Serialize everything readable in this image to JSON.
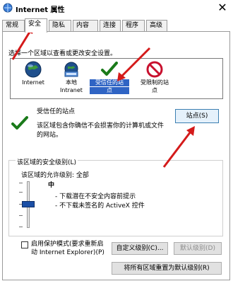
{
  "window": {
    "title": "Internet 属性",
    "close_glyph": "✕"
  },
  "tabs": [
    {
      "label": "常规"
    },
    {
      "label": "安全"
    },
    {
      "label": "隐私"
    },
    {
      "label": "内容"
    },
    {
      "label": "连接"
    },
    {
      "label": "程序"
    },
    {
      "label": "高级"
    }
  ],
  "security": {
    "prompt": "选择一个区域以查看或更改安全设置。",
    "zones": [
      {
        "label_line1": "Internet",
        "label_line2": "",
        "icon": "globe-icon"
      },
      {
        "label_line1": "本地",
        "label_line2": "Intranet",
        "icon": "local-intranet-icon"
      },
      {
        "label_line1": "受信任的站",
        "label_line2": "点",
        "icon": "checkmark-icon"
      },
      {
        "label_line1": "受限制的站",
        "label_line2": "点",
        "icon": "no-entry-icon"
      }
    ],
    "selected_zone": {
      "title": "受信任的站点",
      "description": "该区域包含你确信不会损害你的计算机或文件的网站。"
    },
    "sites_button": "站点(S)",
    "level_group": {
      "title": "该区域的安全级别(L)",
      "allowed_levels": "该区域的允许级别: 全部",
      "level": "中",
      "bullets": [
        "- 下载潜在不安全内容前提示",
        "- 不下载未签名的 ActiveX 控件"
      ],
      "protected_mode_label": "启用保护模式(要求重新启动 Internet Explorer)(P)",
      "protected_mode_checked": false,
      "custom_button": "自定义级别(C)...",
      "default_button": "默认级别(D)"
    },
    "reset_all_button": "将所有区域重置为默认级别(R)"
  },
  "colors": {
    "selection": "#2f64c4",
    "annotation_arrow": "#d41a1a",
    "slider_thumb": "#1b4fa6"
  }
}
